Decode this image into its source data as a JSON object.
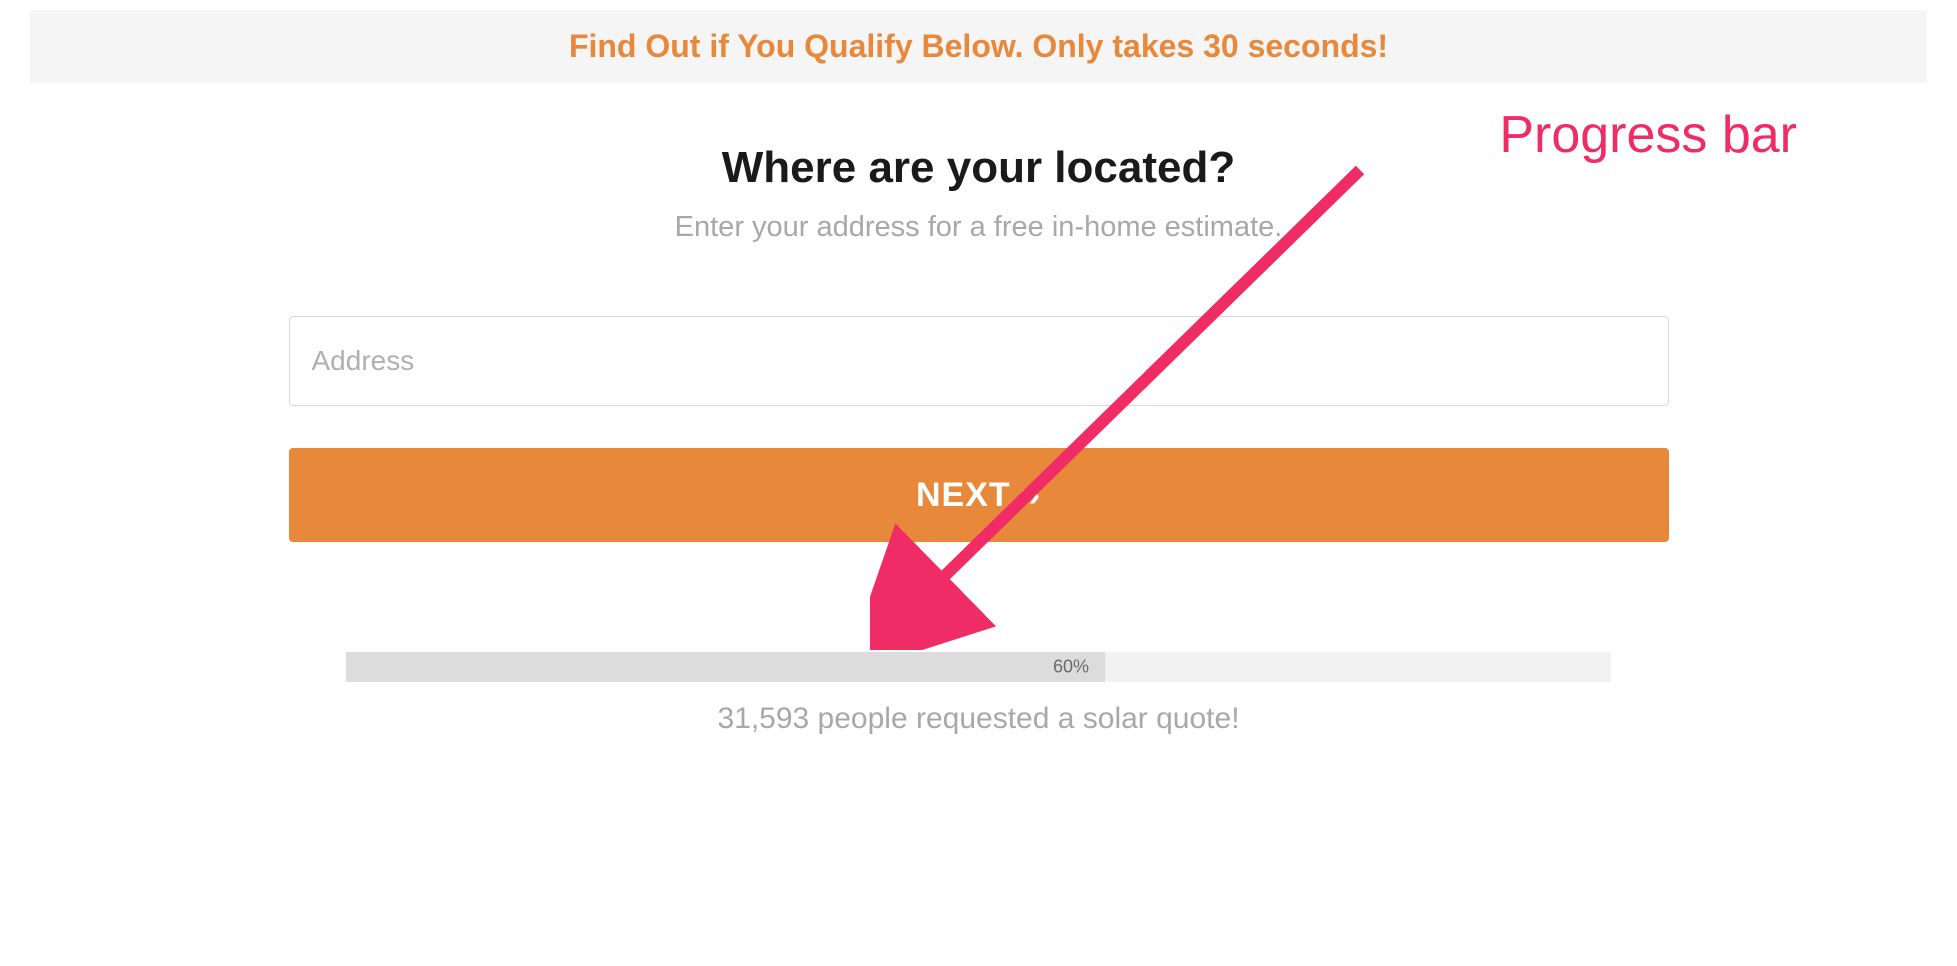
{
  "banner": {
    "text": "Find Out if You Qualify Below. Only takes 30 seconds!"
  },
  "form": {
    "question": "Where are your located?",
    "subtitle": "Enter your address for a free in-home estimate.",
    "address_placeholder": "Address",
    "address_value": "",
    "next_button_label": "NEXT »"
  },
  "progress": {
    "percent": 60,
    "percent_label": "60%",
    "width_style": "width:60%"
  },
  "stats": {
    "text": "31,593 people requested a solar quote!"
  },
  "annotation": {
    "label": "Progress bar"
  },
  "colors": {
    "accent": "#e8883a",
    "annotation": "#ef2c66"
  }
}
